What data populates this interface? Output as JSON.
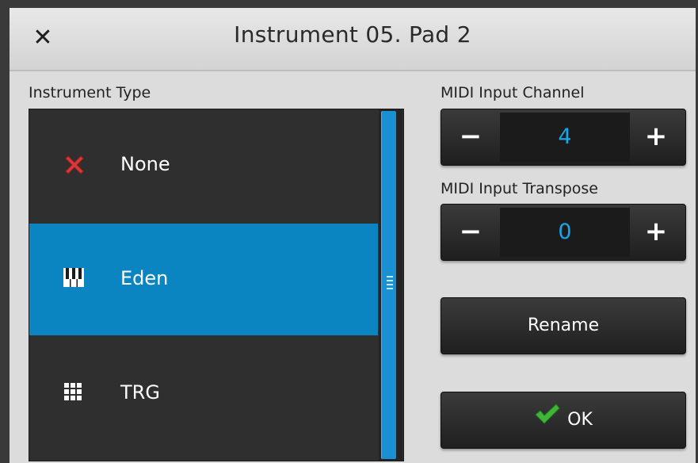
{
  "dialog": {
    "title": "Instrument 05. Pad 2",
    "close_glyph": "✕"
  },
  "instrument_type": {
    "label": "Instrument Type",
    "items": [
      {
        "label": "None",
        "icon": "red-x-icon",
        "selected": false
      },
      {
        "label": "Eden",
        "icon": "piano-keys-icon",
        "selected": true
      },
      {
        "label": "TRG",
        "icon": "grid-icon",
        "selected": false
      }
    ]
  },
  "midi_input_channel": {
    "label": "MIDI Input Channel",
    "value": "4",
    "minus": "−",
    "plus": "+"
  },
  "midi_input_transpose": {
    "label": "MIDI Input Transpose",
    "value": "0",
    "minus": "−",
    "plus": "+"
  },
  "buttons": {
    "rename": "Rename",
    "ok": "OK"
  },
  "colors": {
    "accent": "#0a85c1",
    "value_text": "#19a6e6",
    "check_green": "#3fb63a",
    "x_red": "#d83a3a"
  }
}
